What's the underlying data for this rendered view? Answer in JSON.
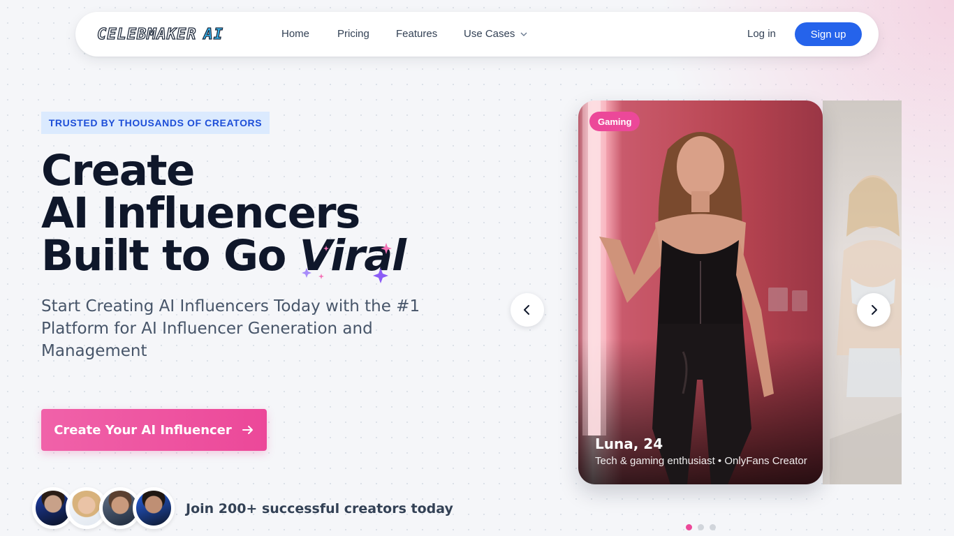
{
  "nav": {
    "logo_main": "CELEBMAKER",
    "logo_accent": "AI",
    "links": [
      "Home",
      "Pricing",
      "Features",
      "Use Cases"
    ],
    "login": "Log in",
    "signup": "Sign up"
  },
  "hero": {
    "badge": "TRUSTED BY THOUSANDS OF CREATORS",
    "headline_line1": "Create",
    "headline_line2": "AI Influencers",
    "headline_line3_prefix": "Built to Go ",
    "headline_line3_emphasis": "Viral",
    "subtitle": "Start Creating AI Influencers Today with the #1 Platform for AI Influencer Generation and Management",
    "cta": "Create Your AI Influencer",
    "social_proof": "Join 200+ successful creators today"
  },
  "carousel": {
    "active_card": {
      "tag": "Gaming",
      "name": "Luna, 24",
      "description": "Tech & gaming enthusiast • OnlyFans Creator"
    },
    "dot_count": 3,
    "active_dot": 1
  },
  "colors": {
    "primary_blue": "#2563eb",
    "accent_pink": "#ec4899",
    "badge_bg": "#dbeafe"
  }
}
